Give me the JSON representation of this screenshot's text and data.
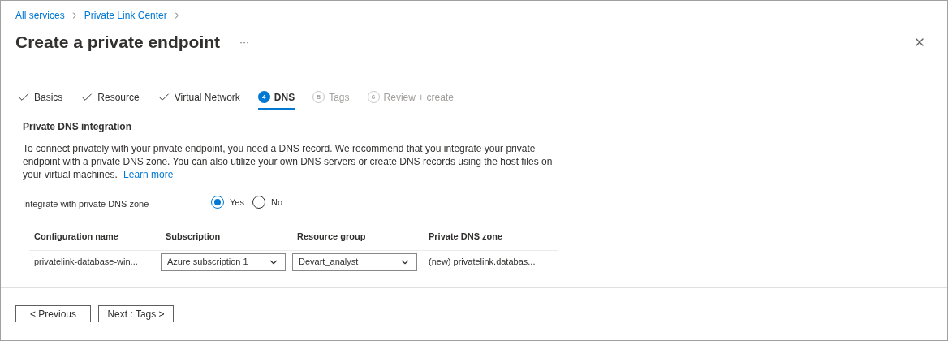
{
  "breadcrumb": [
    {
      "label": "All services"
    },
    {
      "label": "Private Link Center"
    }
  ],
  "title": "Create a private endpoint",
  "more": "···",
  "tabs": [
    {
      "label": "Basics",
      "kind": "done",
      "selected": false,
      "disabled": false
    },
    {
      "label": "Resource",
      "kind": "done",
      "selected": false,
      "disabled": false
    },
    {
      "label": "Virtual Network",
      "kind": "done",
      "selected": false,
      "disabled": false
    },
    {
      "label": "DNS",
      "kind": "numbered",
      "number": "4",
      "selected": true,
      "disabled": false
    },
    {
      "label": "Tags",
      "kind": "numbered",
      "number": "5",
      "selected": false,
      "disabled": true
    },
    {
      "label": "Review + create",
      "kind": "numbered",
      "number": "6",
      "selected": false,
      "disabled": true
    }
  ],
  "section": {
    "heading": "Private DNS integration",
    "description": "To connect privately with your private endpoint, you need a DNS record. We recommend that you integrate your private endpoint with a private DNS zone. You can also utilize your own DNS servers or create DNS records using the host files on your virtual machines.",
    "link": "Learn more"
  },
  "integrate": {
    "label": "Integrate with private DNS zone",
    "options": [
      {
        "label": "Yes",
        "selected": true
      },
      {
        "label": "No",
        "selected": false
      }
    ]
  },
  "table": {
    "columns": [
      "Configuration name",
      "Subscription",
      "Resource group",
      "Private DNS zone"
    ],
    "rows": [
      {
        "cells": [
          {
            "kind": "text",
            "value": "privatelink-database-win..."
          },
          {
            "kind": "dropdown",
            "value": "Azure subscription 1"
          },
          {
            "kind": "dropdown",
            "value": "Devart_analyst"
          },
          {
            "kind": "text",
            "value": "(new) privatelink.databas..."
          }
        ]
      }
    ]
  },
  "buttons": [
    "< Previous",
    "Next : Tags >"
  ]
}
